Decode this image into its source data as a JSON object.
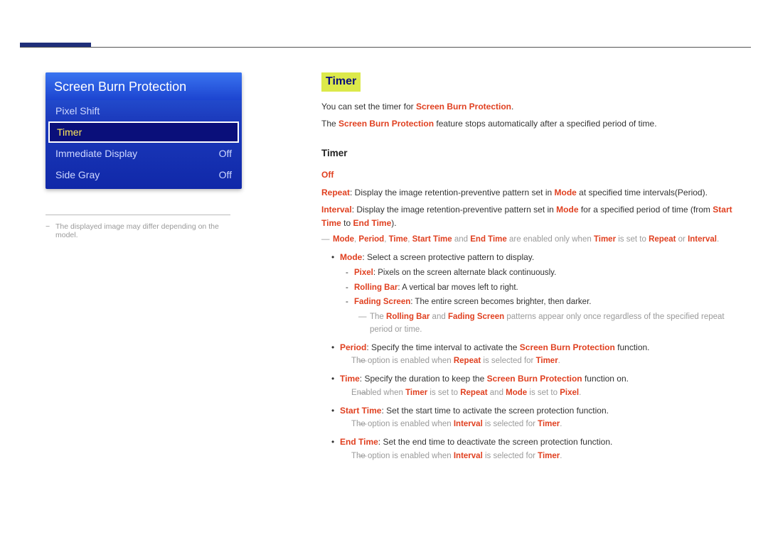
{
  "menu": {
    "title": "Screen Burn Protection",
    "items": [
      {
        "label": "Pixel Shift",
        "value": ""
      },
      {
        "label": "Timer",
        "value": ""
      },
      {
        "label": "Immediate Display",
        "value": "Off"
      },
      {
        "label": "Side Gray",
        "value": "Off"
      }
    ]
  },
  "left_note": "The displayed image may differ depending on the model.",
  "heading": "Timer",
  "intro_1_pre": "You can set the timer for ",
  "intro_1_term": "Screen Burn Protection",
  "intro_1_post": ".",
  "intro_2_pre": "The ",
  "intro_2_term": "Screen Burn Protection",
  "intro_2_post": " feature stops automatically after a specified period of time.",
  "subheading": "Timer",
  "off_label": "Off",
  "repeat": {
    "term": "Repeat",
    "pre": ": Display the image retention-preventive pattern set in ",
    "mode": "Mode",
    "post": " at specified time intervals(Period)."
  },
  "interval": {
    "term": "Interval",
    "pre": ": Display the image retention-preventive pattern set in ",
    "mode": "Mode",
    "post1": " for a specified period of time (from ",
    "start": "Start Time",
    "mid": " to ",
    "end": "End Time",
    "post2": ")."
  },
  "note1": {
    "t1": "Mode",
    "t2": "Period",
    "t3": "Time",
    "t4": "Start Time",
    "t5": "End Time",
    "mid1": " and ",
    "mid2": " are enabled only when ",
    "t6": "Timer",
    "mid3": " is set to ",
    "t7": "Repeat",
    "mid4": " or ",
    "t8": "Interval",
    "end": "."
  },
  "mode_line": {
    "term": "Mode",
    "text": ": Select a screen protective pattern to display."
  },
  "pixel_line": {
    "term": "Pixel",
    "text": ": Pixels on the screen alternate black continuously."
  },
  "rolling_line": {
    "term": "Rolling Bar",
    "text": ": A vertical bar moves left to right."
  },
  "fading_line": {
    "term": "Fading Screen",
    "text": ": The entire screen becomes brighter, then darker."
  },
  "note_patterns": {
    "pre": "The ",
    "t1": "Rolling Bar",
    "mid1": " and ",
    "t2": "Fading Screen",
    "post": " patterns appear only once regardless of the specified repeat period or time."
  },
  "period_line": {
    "term": "Period",
    "pre": ": Specify the time interval to activate the ",
    "sbp": "Screen Burn Protection",
    "post": " function."
  },
  "period_note": {
    "pre": "The option is enabled when ",
    "t1": "Repeat",
    "mid": " is selected for ",
    "t2": "Timer",
    "end": "."
  },
  "time_line": {
    "term": "Time",
    "pre": ": Specify the duration to keep the ",
    "sbp": "Screen Burn Protection",
    "post": " function on."
  },
  "time_note": {
    "pre": "Enabled when ",
    "t1": "Timer",
    "mid1": " is set to ",
    "t2": "Repeat",
    "mid2": " and ",
    "t3": "Mode",
    "mid3": " is set to ",
    "t4": "Pixel",
    "end": "."
  },
  "start_line": {
    "term": "Start Time",
    "text": ": Set the start time to activate the screen protection function."
  },
  "start_note": {
    "pre": "The option is enabled when ",
    "t1": "Interval",
    "mid": " is selected for ",
    "t2": "Timer",
    "end": "."
  },
  "end_line": {
    "term": "End Time",
    "text": ": Set the end time to deactivate the screen protection function."
  },
  "end_note": {
    "pre": "The option is enabled when ",
    "t1": "Interval",
    "mid": " is selected for ",
    "t2": "Timer",
    "end": "."
  }
}
